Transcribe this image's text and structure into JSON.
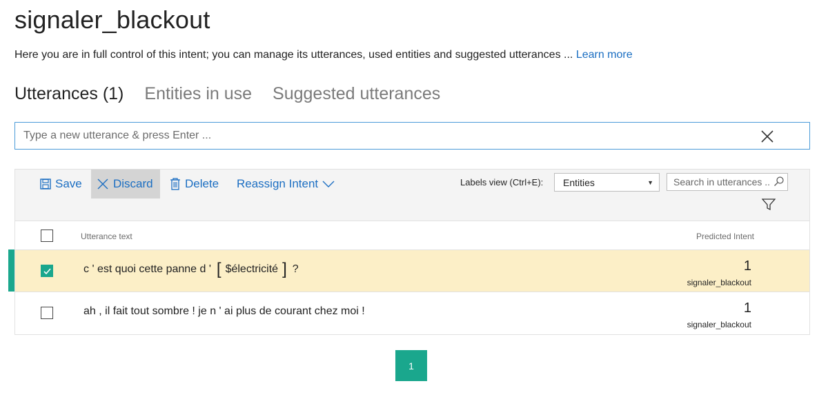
{
  "header": {
    "title": "signaler_blackout",
    "intro": "Here you are in full control of this intent; you can manage its utterances, used entities and suggested utterances ... ",
    "learn_more": "Learn more"
  },
  "tabs": [
    {
      "label": "Utterances (1)",
      "active": true
    },
    {
      "label": "Entities in use",
      "active": false
    },
    {
      "label": "Suggested utterances",
      "active": false
    }
  ],
  "utterance_input": {
    "placeholder": "Type a new utterance & press Enter ...",
    "value": ""
  },
  "toolbar": {
    "save_label": "Save",
    "discard_label": "Discard",
    "delete_label": "Delete",
    "reassign_label": "Reassign Intent",
    "labels_view_label": "Labels view (Ctrl+E):",
    "labels_view_value": "Entities",
    "search_placeholder": "Search in utterances ..."
  },
  "table": {
    "col_text": "Utterance text",
    "col_intent": "Predicted Intent",
    "rows": [
      {
        "checked": true,
        "text_before": "c ' est quoi cette panne d '",
        "entity": "$électricité",
        "text_after": "?",
        "score": "1",
        "intent": "signaler_blackout"
      },
      {
        "checked": false,
        "text": "ah , il fait tout sombre ! je n ' ai plus de courant chez moi !",
        "score": "1",
        "intent": "signaler_blackout"
      }
    ]
  },
  "pagination": {
    "current": "1"
  },
  "colors": {
    "accent": "#1aa78d",
    "link": "#1b6ec2",
    "selected_row": "#fcefc7"
  }
}
